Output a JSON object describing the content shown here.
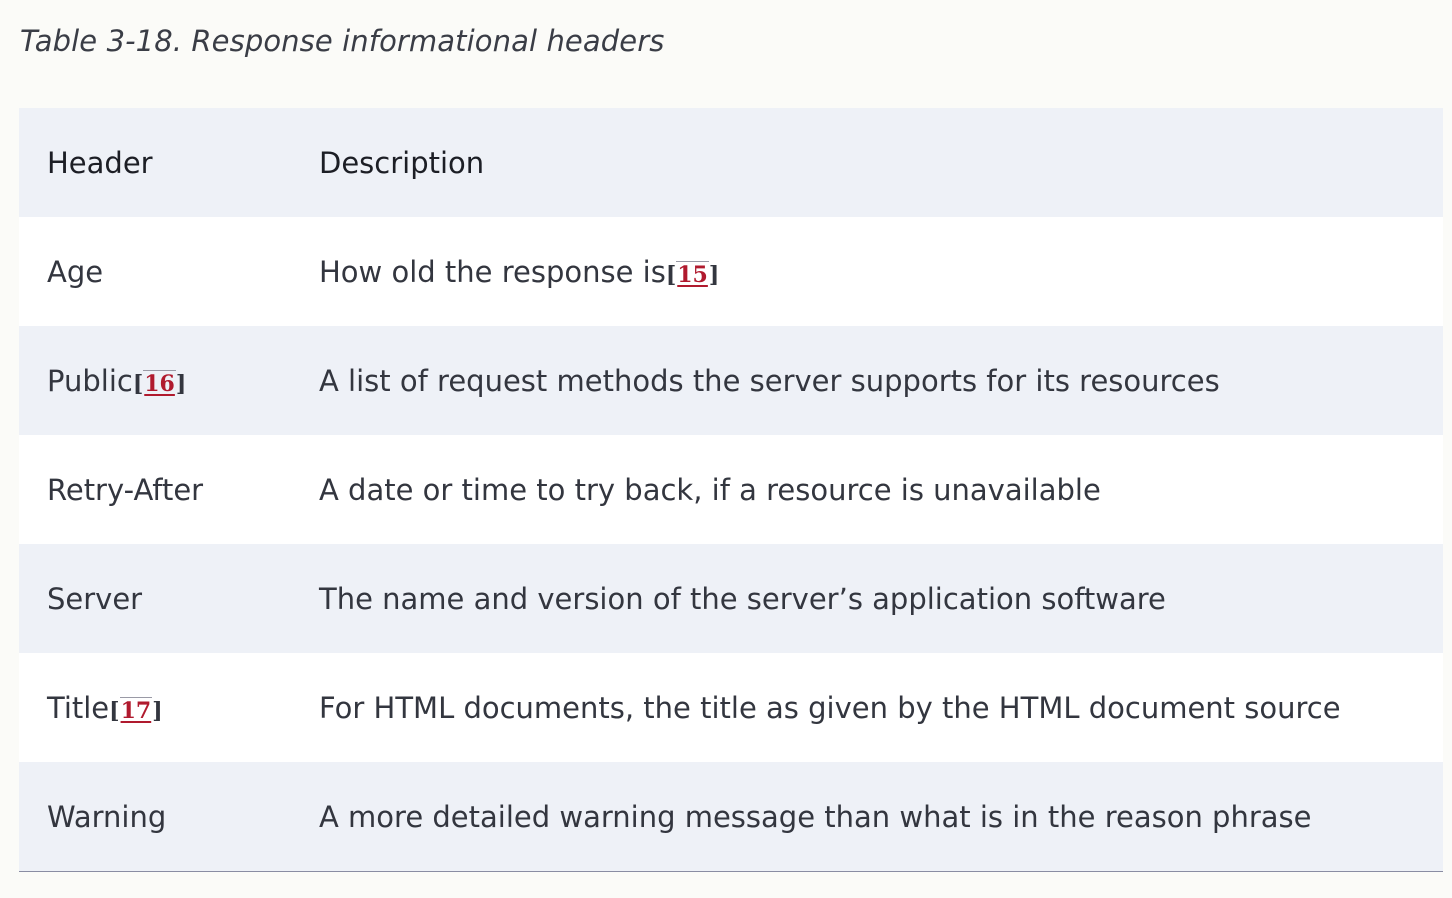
{
  "caption": "Table 3-18. Response informational headers",
  "columns": {
    "header": "Header",
    "description": "Description"
  },
  "rows": [
    {
      "header": "Age",
      "header_fn": "",
      "description": "How old the response is",
      "desc_fn": "15"
    },
    {
      "header": "Public",
      "header_fn": "16",
      "description": "A list of request methods the server supports for its resources",
      "desc_fn": ""
    },
    {
      "header": "Retry-After",
      "header_fn": "",
      "description": "A date or time to try back, if a resource is unavailable",
      "desc_fn": ""
    },
    {
      "header": "Server",
      "header_fn": "",
      "description": "The name and version of the server’s application software",
      "desc_fn": ""
    },
    {
      "header": "Title",
      "header_fn": "17",
      "description": "For HTML documents, the title as given by the HTML document source",
      "desc_fn": ""
    },
    {
      "header": "Warning",
      "header_fn": "",
      "description": "A more detailed warning message than what is in the reason phrase",
      "desc_fn": ""
    }
  ],
  "colors": {
    "footnote_link": "#b01a2e",
    "row_shade": "#eef1f7",
    "row_plain": "#ffffff",
    "page_bg": "#fbfbf8"
  }
}
